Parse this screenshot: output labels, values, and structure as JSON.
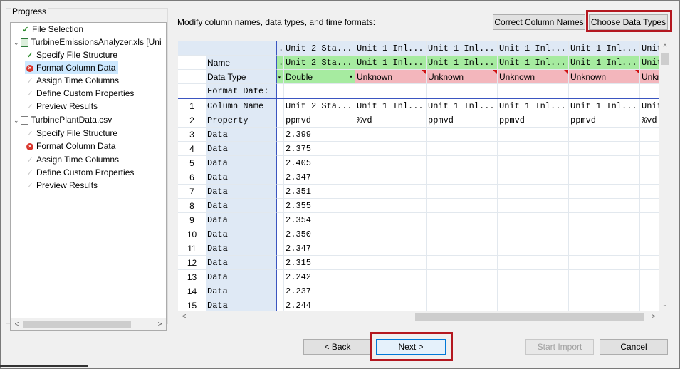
{
  "progress": {
    "title": "Progress",
    "items": [
      {
        "label": "File Selection",
        "state": "done"
      },
      {
        "label": "TurbineEmissionsAnalyzer.xls [Uni",
        "state": "file"
      },
      {
        "label": "Specify File Structure",
        "state": "done"
      },
      {
        "label": "Format Column Data",
        "state": "error"
      },
      {
        "label": "Assign Time Columns",
        "state": "pending"
      },
      {
        "label": "Define Custom Properties",
        "state": "pending"
      },
      {
        "label": "Preview Results",
        "state": "pending"
      },
      {
        "label": "TurbinePlantData.csv",
        "state": "file"
      },
      {
        "label": "Specify File Structure",
        "state": "pending"
      },
      {
        "label": "Format Column Data",
        "state": "error"
      },
      {
        "label": "Assign Time Columns",
        "state": "pending"
      },
      {
        "label": "Define Custom Properties",
        "state": "pending"
      },
      {
        "label": "Preview Results",
        "state": "pending"
      }
    ]
  },
  "header": {
    "instructions": "Modify column names, data types, and time formats:",
    "correct_label": "Correct Column Names",
    "choose_label": "Choose Data Types"
  },
  "grid": {
    "col_headers": [
      "Unit 2 Sta...",
      "Unit 1 Inl...",
      "Unit 1 Inl...",
      "Unit 1 Inl...",
      "Unit 1 Inl...",
      "Unit"
    ],
    "name_row": {
      "label": "Name",
      "values": [
        "Unit 2 Sta...",
        "Unit 1 Inl...",
        "Unit 1 Inl...",
        "Unit 1 Inl...",
        "Unit 1 Inl...",
        "Unit"
      ]
    },
    "type_row": {
      "label": "Data Type",
      "values": [
        "Double",
        "Unknown",
        "Unknown",
        "Unknown",
        "Unknown",
        "Unkn"
      ]
    },
    "format_row": {
      "label": "Format Date:"
    },
    "rows": [
      {
        "num": "1",
        "label": "Column Name",
        "values": [
          "Unit 2 Sta...",
          "Unit 1 Inl...",
          "Unit 1 Inl...",
          "Unit 1 Inl...",
          "Unit 1 Inl...",
          "Unit"
        ]
      },
      {
        "num": "2",
        "label": "Property",
        "values": [
          "ppmvd",
          "%vd",
          "ppmvd",
          "ppmvd",
          "ppmvd",
          "%vd"
        ]
      },
      {
        "num": "3",
        "label": "Data",
        "values": [
          "2.399",
          "",
          "",
          "",
          "",
          ""
        ]
      },
      {
        "num": "4",
        "label": "Data",
        "values": [
          "2.375",
          "",
          "",
          "",
          "",
          ""
        ]
      },
      {
        "num": "5",
        "label": "Data",
        "values": [
          "2.405",
          "",
          "",
          "",
          "",
          ""
        ]
      },
      {
        "num": "6",
        "label": "Data",
        "values": [
          "2.347",
          "",
          "",
          "",
          "",
          ""
        ]
      },
      {
        "num": "7",
        "label": "Data",
        "values": [
          "2.351",
          "",
          "",
          "",
          "",
          ""
        ]
      },
      {
        "num": "8",
        "label": "Data",
        "values": [
          "2.355",
          "",
          "",
          "",
          "",
          ""
        ]
      },
      {
        "num": "9",
        "label": "Data",
        "values": [
          "2.354",
          "",
          "",
          "",
          "",
          ""
        ]
      },
      {
        "num": "10",
        "label": "Data",
        "values": [
          "2.350",
          "",
          "",
          "",
          "",
          ""
        ]
      },
      {
        "num": "11",
        "label": "Data",
        "values": [
          "2.347",
          "",
          "",
          "",
          "",
          ""
        ]
      },
      {
        "num": "12",
        "label": "Data",
        "values": [
          "2.315",
          "",
          "",
          "",
          "",
          ""
        ]
      },
      {
        "num": "13",
        "label": "Data",
        "values": [
          "2.242",
          "",
          "",
          "",
          "",
          ""
        ]
      },
      {
        "num": "14",
        "label": "Data",
        "values": [
          "2.237",
          "",
          "",
          "",
          "",
          ""
        ]
      },
      {
        "num": "15",
        "label": "Data",
        "values": [
          "2.244",
          "",
          "",
          "",
          "",
          ""
        ]
      }
    ]
  },
  "footer": {
    "back_label": "< Back",
    "next_label": "Next >",
    "start_label": "Start Import",
    "cancel_label": "Cancel"
  },
  "colors": {
    "highlight": "#b41820",
    "name_bg": "#a6eba0",
    "unknown_bg": "#f3b6bc"
  }
}
